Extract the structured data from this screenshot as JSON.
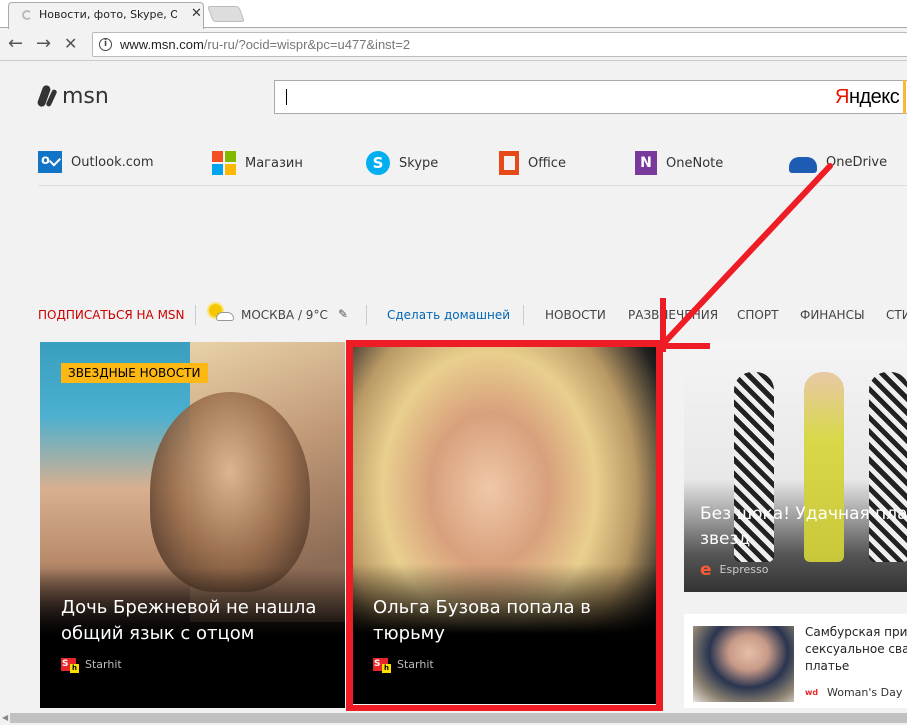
{
  "browser": {
    "tab_title": "Новости, фото, Skype, O",
    "url_host": "www.msn.com",
    "url_path": "/ru-ru/?ocid=wispr&pc=u477&inst=2",
    "back_icon": "←",
    "forward_icon": "→",
    "stop_icon": "✕",
    "tab_close_icon": "✕"
  },
  "header": {
    "logo_text": "msn",
    "search_value": "",
    "search_provider_first": "Я",
    "search_provider_rest": "ндекс"
  },
  "apps": [
    {
      "label": "Outlook.com",
      "icon": "outlook-icon"
    },
    {
      "label": "Магазин",
      "icon": "microsoft-store-icon"
    },
    {
      "label": "Skype",
      "icon": "skype-icon"
    },
    {
      "label": "Office",
      "icon": "office-icon"
    },
    {
      "label": "OneNote",
      "icon": "onenote-icon"
    },
    {
      "label": "OneDrive",
      "icon": "onedrive-icon"
    }
  ],
  "navbar": {
    "subscribe": "ПОДПИСАТЬСЯ НА MSN",
    "weather": "МОСКВА / 9°C",
    "make_home": "Сделать домашней",
    "sections": [
      "НОВОСТИ",
      "РАЗВЛЕЧЕНИЯ",
      "СПОРТ",
      "ФИНАНСЫ",
      "СТИ"
    ]
  },
  "cards": [
    {
      "badge": "ЗВЕЗДНЫЕ НОВОСТИ",
      "title_line1": "Дочь Брежневой не нашла",
      "title_line2": "общий язык с отцом",
      "source": "Starhit"
    },
    {
      "title_line1": "Ольга Бузова попала в",
      "title_line2": "тюрьму",
      "source": "Starhit"
    },
    {
      "title_line1": "Без шока! Удачная пла",
      "title_line2": "звезд",
      "source": "Espresso"
    },
    {
      "title_line1": "Самбурская прим",
      "title_line2": "сексуальное свад",
      "title_line3": "платье",
      "source": "Woman's Day"
    }
  ],
  "annotation": {
    "color": "#ee1c24"
  }
}
